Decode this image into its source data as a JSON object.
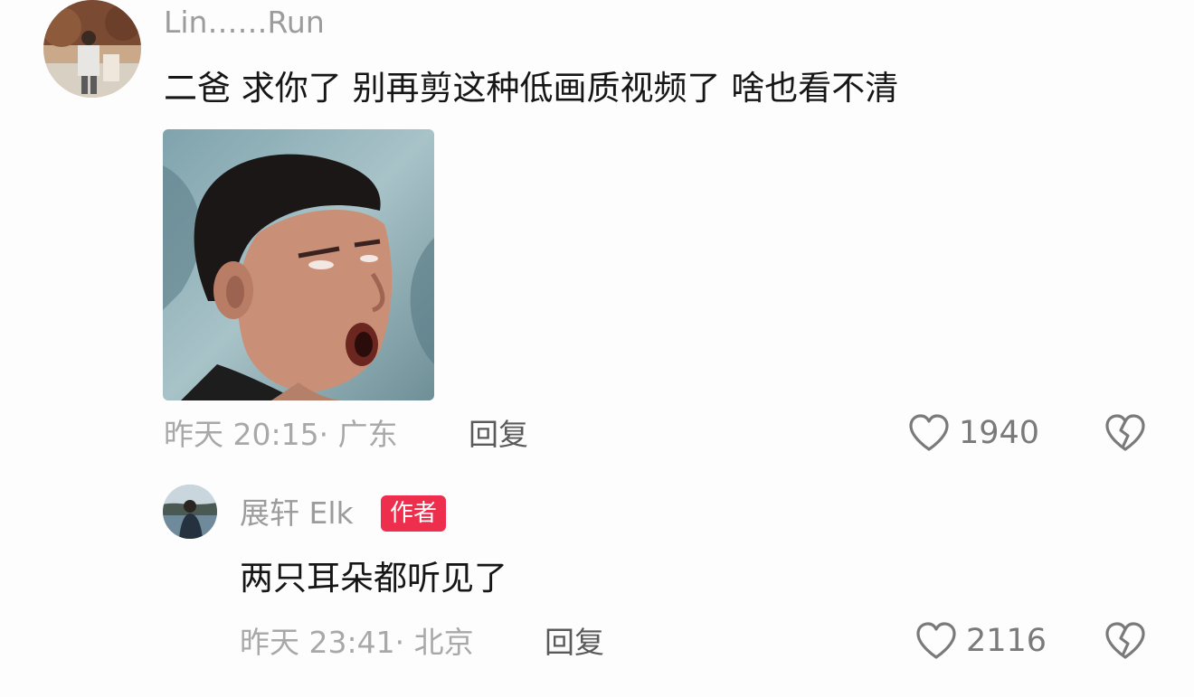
{
  "comments": [
    {
      "username": "Lin……Run",
      "text": "二爸 求你了 别再剪这种低画质视频了 啥也看不清",
      "meta": "昨天 20:15· 广东",
      "reply_label": "回复",
      "likes": "1940",
      "icons": {
        "like": "heart-outline-icon",
        "dislike": "broken-heart-icon"
      }
    },
    {
      "username": "展轩 Elk",
      "badge": "作者",
      "text": "两只耳朵都听见了",
      "meta": "昨天 23:41· 北京",
      "reply_label": "回复",
      "likes": "2116",
      "icons": {
        "like": "heart-outline-icon",
        "dislike": "broken-heart-icon"
      }
    }
  ],
  "colors": {
    "background": "#fdfdfd",
    "username": "#9c9c9c",
    "text": "#161616",
    "meta": "#a8a8a8",
    "badge": "#ee2e4d"
  }
}
